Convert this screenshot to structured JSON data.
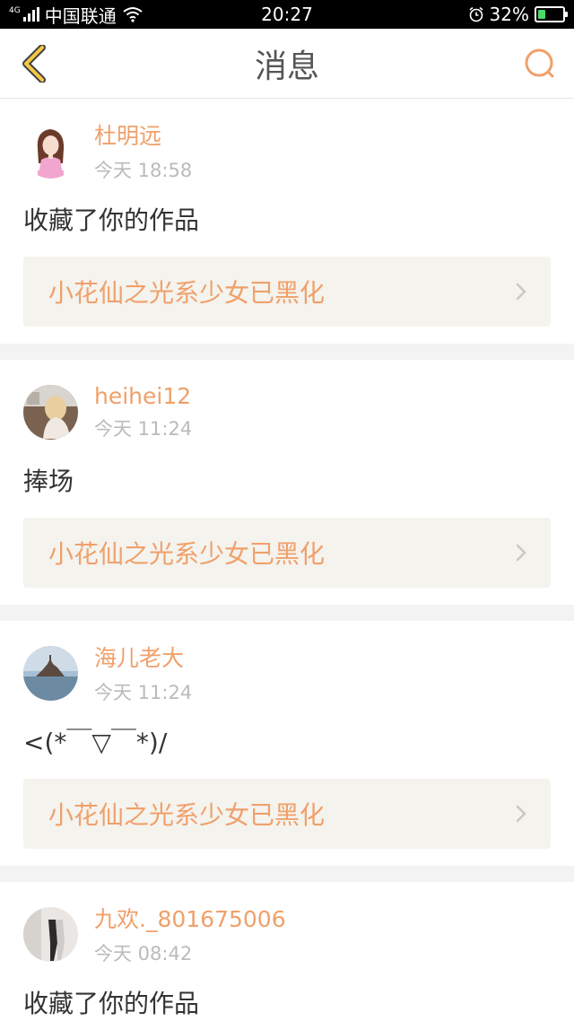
{
  "status_bar": {
    "network_tag": "4G",
    "carrier": "中国联通",
    "time": "20:27",
    "battery": "32%",
    "battery_level": 0.32
  },
  "header": {
    "title": "消息",
    "back_icon": "chevron-left-icon",
    "search_icon": "search-icon"
  },
  "messages": [
    {
      "username": "杜明远",
      "time": "今天 18:58",
      "text": "收藏了你的作品",
      "work_title": "小花仙之光系少女已黑化"
    },
    {
      "username": "heihei12",
      "time": "今天 11:24",
      "text": "捧场",
      "work_title": "小花仙之光系少女已黑化"
    },
    {
      "username": "海儿老大",
      "time": "今天 11:24",
      "text": "<(*￣▽￣*)/",
      "work_title": "小花仙之光系少女已黑化"
    },
    {
      "username": "九欢._801675006",
      "time": "今天 08:42",
      "text": "收藏了你的作品"
    }
  ],
  "colors": {
    "accent": "#f0a06a",
    "back_icon": "#f5c842",
    "status_bar_bg": "#000000",
    "link_bg": "#f4f3ee"
  }
}
